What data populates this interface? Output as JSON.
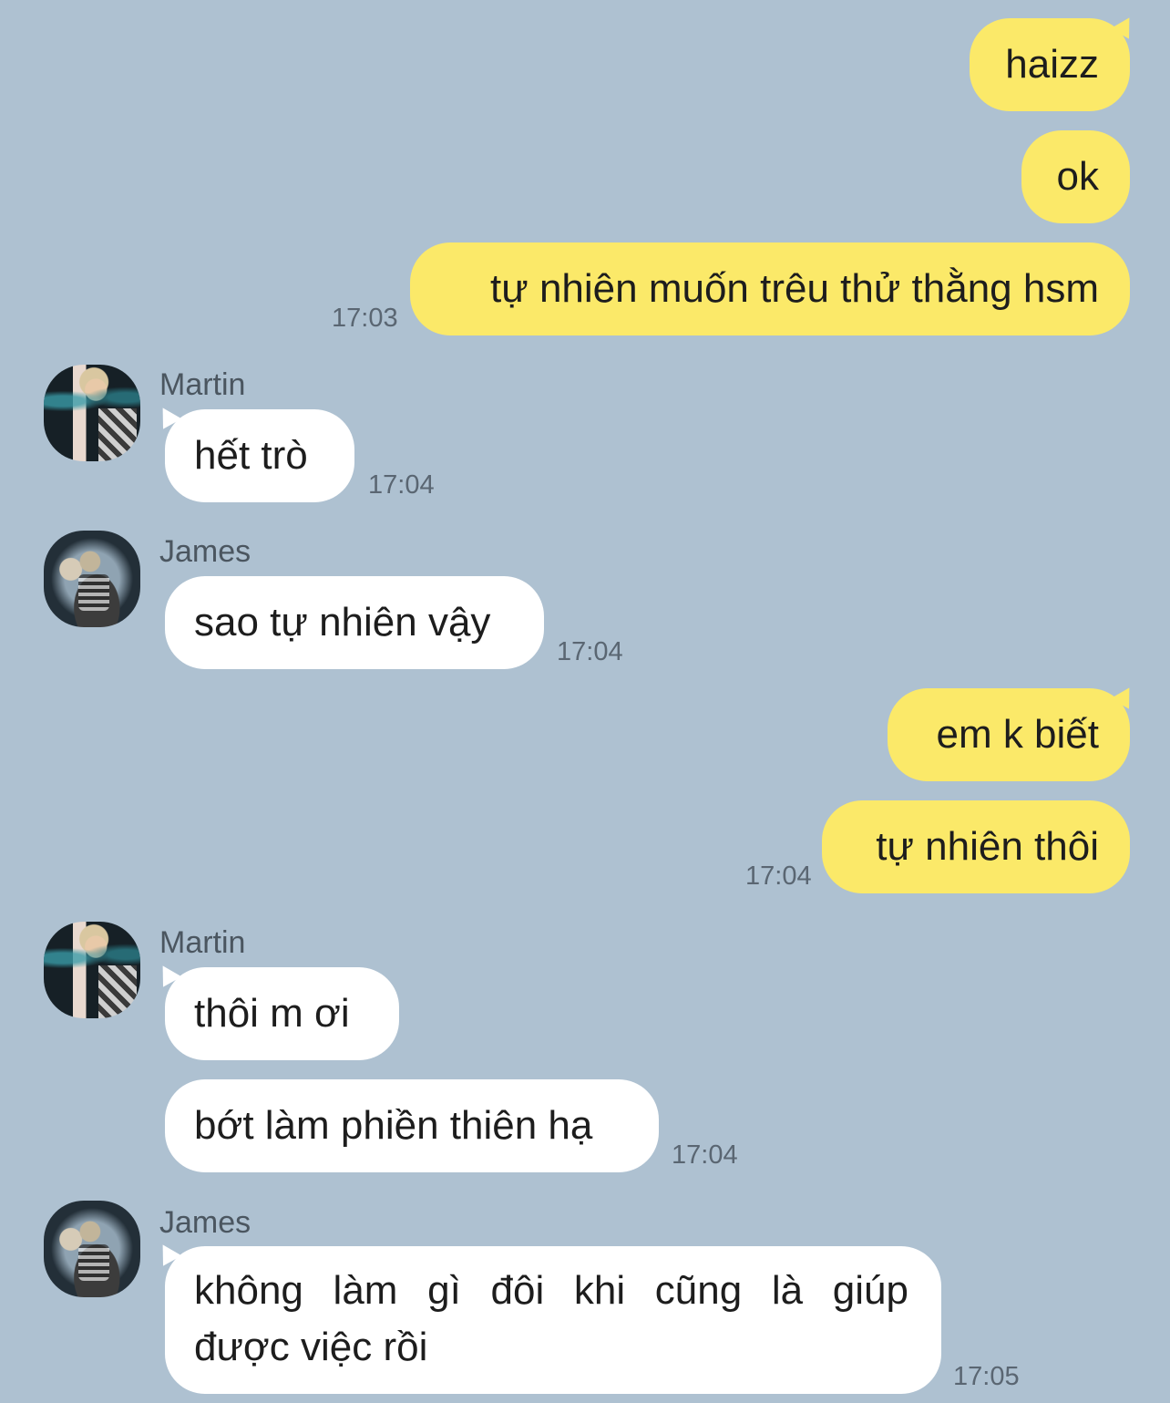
{
  "chat": {
    "messages": [
      {
        "sender": "me",
        "text": "haizz"
      },
      {
        "sender": "me",
        "text": "ok"
      },
      {
        "sender": "me",
        "text": "tự nhiên muốn trêu thử thằng hsm",
        "time": "17:03"
      },
      {
        "sender": "Martin",
        "text": "hết trò",
        "time": "17:04"
      },
      {
        "sender": "James",
        "text": "sao tự nhiên vậy",
        "time": "17:04"
      },
      {
        "sender": "me",
        "text": "em k biết"
      },
      {
        "sender": "me",
        "text": "tự nhiên thôi",
        "time": "17:04"
      },
      {
        "sender": "Martin",
        "text": "thôi m ơi"
      },
      {
        "sender": "Martin",
        "text": "bớt làm phiền thiên hạ",
        "time": "17:04"
      },
      {
        "sender": "James",
        "text": "không làm gì đôi khi cũng là giúp được việc rồi",
        "lines": [
          "không làm gì đôi khi cũng là giúp",
          "được việc rồi"
        ],
        "time": "17:05"
      }
    ],
    "names": {
      "martin": "Martin",
      "james": "James"
    }
  },
  "colors": {
    "background": "#aec1d1",
    "outgoing_bubble": "#fbe969",
    "incoming_bubble": "#ffffff"
  }
}
